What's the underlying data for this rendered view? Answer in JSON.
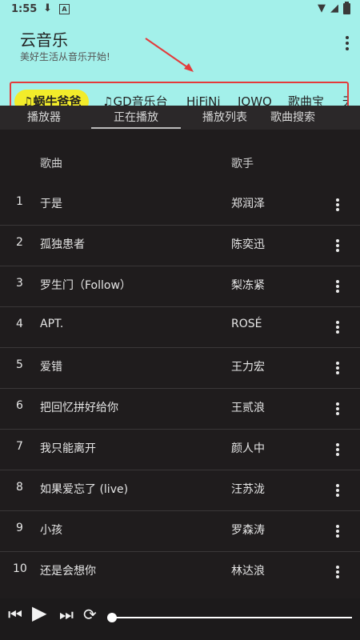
{
  "status": {
    "time": "1:55",
    "download_icon": "download-icon",
    "a_label": "A"
  },
  "app": {
    "title": "云音乐",
    "subtitle": "美好生活从音乐开始!",
    "more_icon": "more-vert-icon"
  },
  "sources": [
    {
      "label": "♫蜗牛爸爸",
      "active": true
    },
    {
      "label": "♫GD音乐台"
    },
    {
      "label": "HiFiNi"
    },
    {
      "label": "IQWQ"
    },
    {
      "label": "歌曲宝"
    },
    {
      "label": "无损"
    }
  ],
  "tabs": [
    "播放器",
    "正在播放",
    "播放列表",
    "歌曲搜索"
  ],
  "table": {
    "headers": {
      "song": "歌曲",
      "artist": "歌手"
    },
    "rows": [
      {
        "num": "1",
        "title": "于是",
        "artist": "郑润泽"
      },
      {
        "num": "2",
        "title": "孤独患者",
        "artist": "陈奕迅"
      },
      {
        "num": "3",
        "title": "罗生门（Follow）",
        "artist": "梨冻紧"
      },
      {
        "num": "4",
        "title": "APT.",
        "artist": "ROSÉ"
      },
      {
        "num": "5",
        "title": "爱错",
        "artist": "王力宏"
      },
      {
        "num": "6",
        "title": "把回忆拼好给你",
        "artist": "王贰浪"
      },
      {
        "num": "7",
        "title": "我只能离开",
        "artist": "颜人中"
      },
      {
        "num": "8",
        "title": "如果爱忘了 (live)",
        "artist": "汪苏泷"
      },
      {
        "num": "9",
        "title": "小孩",
        "artist": "罗森涛"
      },
      {
        "num": "10",
        "title": "还是会想你",
        "artist": "林达浪"
      }
    ]
  },
  "player": {
    "progress": 0.0
  }
}
